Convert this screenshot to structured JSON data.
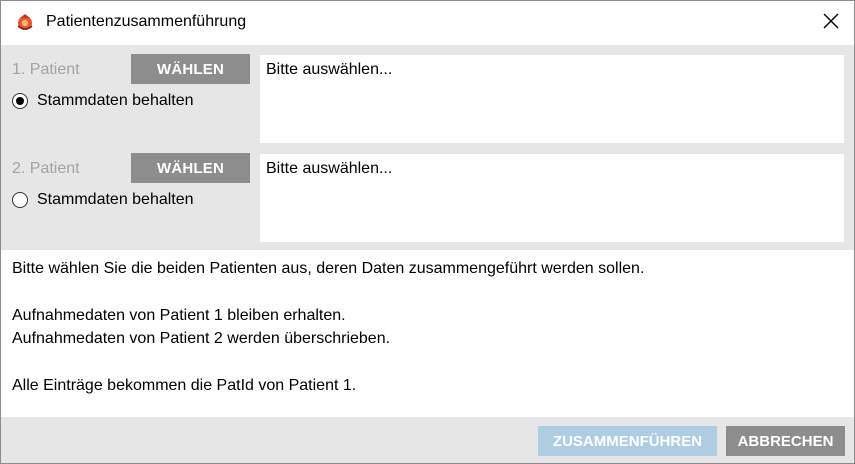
{
  "window": {
    "title": "Patientenzusammenführung",
    "app_icon": "app-logo-icon",
    "close_icon": "close-icon"
  },
  "patients": [
    {
      "label": "1. Patient",
      "choose_label": "WÄHLEN",
      "radio_label": "Stammdaten behalten",
      "radio_checked": true,
      "selection_text": "Bitte auswählen..."
    },
    {
      "label": "2. Patient",
      "choose_label": "WÄHLEN",
      "radio_label": "Stammdaten behalten",
      "radio_checked": false,
      "selection_text": "Bitte auswählen..."
    }
  ],
  "info": {
    "line1": "Bitte wählen Sie die beiden Patienten aus, deren Daten zusammengeführt werden sollen.",
    "line2": "Aufnahmedaten von Patient 1 bleiben erhalten.",
    "line3": "Aufnahmedaten von Patient 2 werden überschrieben.",
    "line4": "Alle Einträge bekommen die PatId von Patient 1."
  },
  "footer": {
    "merge_label": "ZUSAMMENFÜHREN",
    "merge_enabled": false,
    "cancel_label": "ABBRECHEN"
  },
  "colors": {
    "button_gray": "#8d8d8d",
    "button_disabled_blue": "#aecde3",
    "panel_gray": "#e6e6e6",
    "label_gray": "#a3a3a3"
  }
}
